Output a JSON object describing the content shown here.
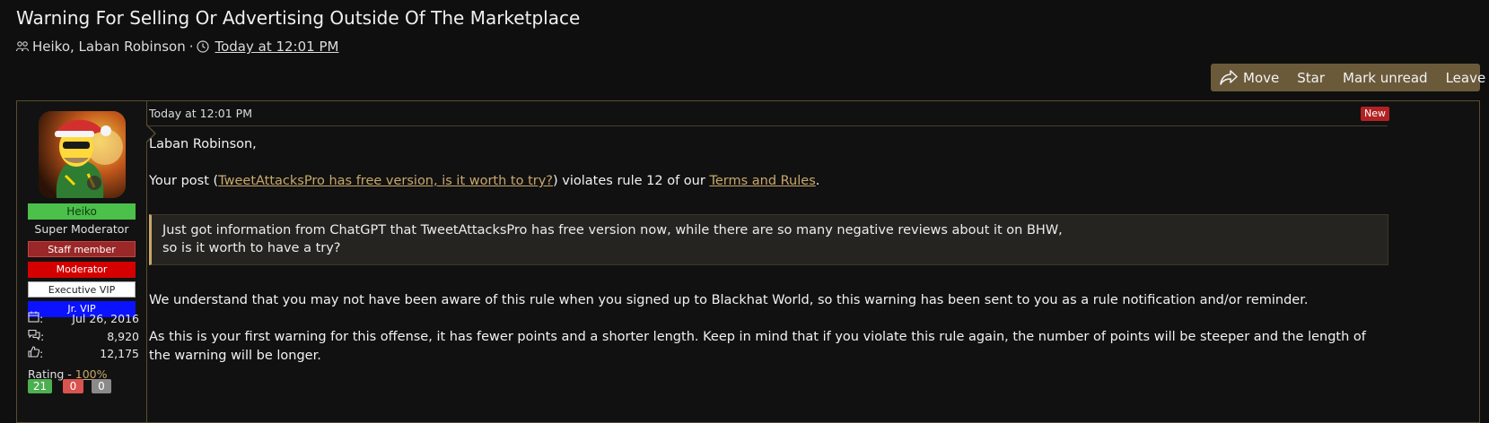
{
  "thread": {
    "title": "Warning For Selling Or Advertising Outside Of The Marketplace",
    "participants": "Heiko, Laban Robinson",
    "separator": "·",
    "time": "Today at 12:01 PM"
  },
  "actions": {
    "move": "Move",
    "star": "Star",
    "mark_unread": "Mark unread",
    "leave": "Leave"
  },
  "user": {
    "name": "Heiko",
    "title": "Super Moderator",
    "badges": {
      "staff": "Staff member",
      "moderator": "Moderator",
      "executive": "Executive VIP",
      "jr_vip": "Jr. VIP"
    },
    "stats": {
      "sep": ":",
      "joined": "Jul 26, 2016",
      "messages": "8,920",
      "reactions": "12,175"
    },
    "rating_label": "Rating - ",
    "rating_value": "100%",
    "rating_positive": "21",
    "rating_negative": "0",
    "rating_neutral": "0"
  },
  "message": {
    "time": "Today at 12:01 PM",
    "new_badge": "New",
    "greeting": "Laban Robinson,",
    "p2_prefix": "Your post (",
    "p2_link": "TweetAttacksPro has free version, is it worth to try?",
    "p2_middle": ") violates rule 12 of our ",
    "p2_link2": "Terms and Rules",
    "p2_suffix": ".",
    "quote_line1": "Just got information from ChatGPT that TweetAttacksPro has free version now, while there are so many negative reviews about it on BHW,",
    "quote_line2": "so is it worth to have a try?",
    "p3": "We understand that you may not have been aware of this rule when you signed up to Blackhat World, so this warning has been sent to you as a rule notification and/or reminder.",
    "p4": "As this is your first warning for this offense, it has fewer points and a shorter length. Keep in mind that if you violate this rule again, the number of points will be steeper and the length of the warning will be longer."
  },
  "colors": {
    "background": "#0f0f0f",
    "accent": "#c9a86a",
    "action_bar": "#6b5a3a",
    "username_bg": "#4bc04b"
  },
  "icons": {
    "participants": "users-icon",
    "clock": "clock-icon",
    "move": "share-arrow-icon",
    "joined": "calendar-icon",
    "messages": "comments-icon",
    "reactions": "thumbs-up-icon"
  }
}
